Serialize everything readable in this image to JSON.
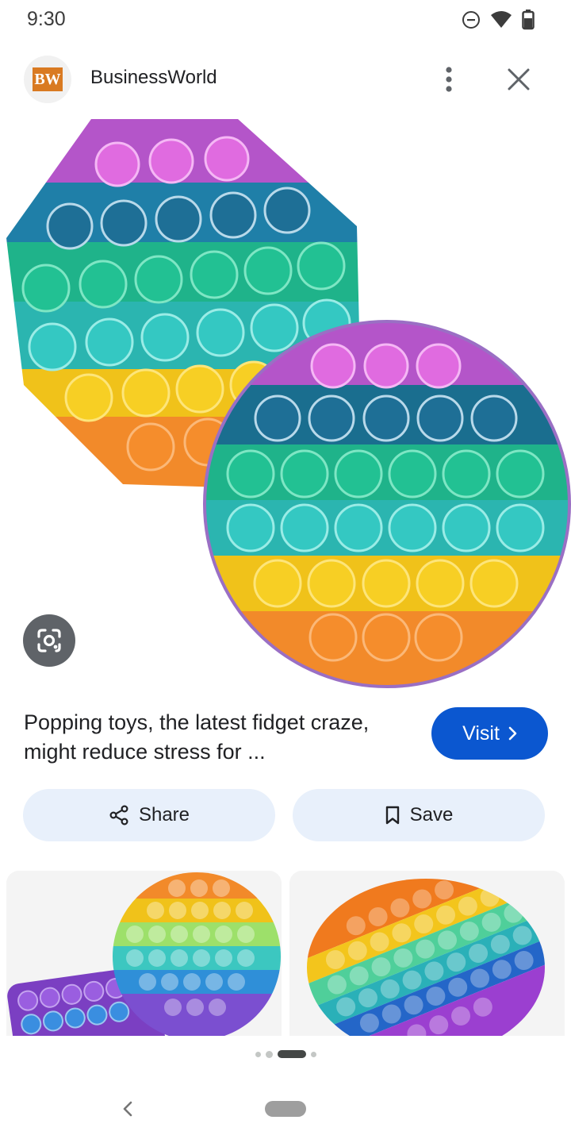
{
  "status_bar": {
    "time": "9:30",
    "icons": [
      "do-not-disturb-icon",
      "wifi-icon",
      "battery-icon"
    ]
  },
  "header": {
    "logo_text": "BW",
    "site_name": "BusinessWorld",
    "icons": [
      "more-vert-icon",
      "close-icon"
    ]
  },
  "main_image": {
    "subject": "rainbow pop-it fidget toys (octagon and circle)"
  },
  "lens_button": {
    "icon": "google-lens-icon"
  },
  "result": {
    "title": "Popping toys, the latest fidget craze, might reduce stress for ...",
    "visit_label": "Visit",
    "visit_icon": "chevron-right-icon"
  },
  "actions": {
    "share_label": "Share",
    "save_label": "Save"
  },
  "related_images": [
    "rainbow circle pop-it with purple square pop-it",
    "diagonal rainbow circle pop-it"
  ],
  "pager": {
    "count": 4,
    "active_index": 2
  },
  "colors": {
    "accent": "#0b57d0",
    "action_bg": "#e8f0fb",
    "logo": "#d97a22"
  }
}
